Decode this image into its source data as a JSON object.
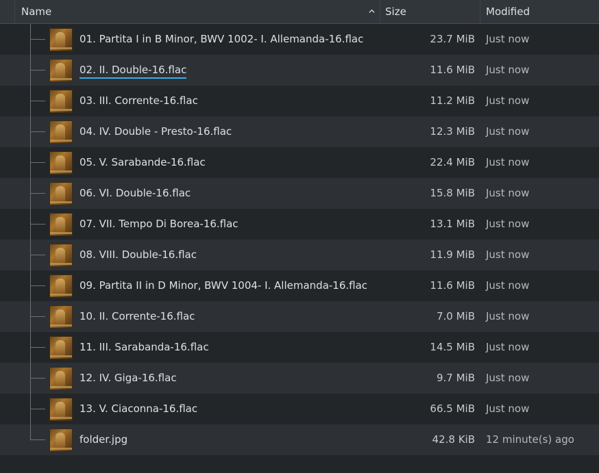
{
  "header": {
    "name_label": "Name",
    "size_label": "Size",
    "modified_label": "Modified",
    "sort_icon": "chevron-up-icon"
  },
  "files": [
    {
      "name": "01. Partita I in B Minor, BWV 1002- I. Allemanda-16.flac",
      "size": "23.7 MiB",
      "modified": "Just now"
    },
    {
      "name": "02. II. Double-16.flac",
      "size": "11.6 MiB",
      "modified": "Just now"
    },
    {
      "name": "03. III. Corrente-16.flac",
      "size": "11.2 MiB",
      "modified": "Just now"
    },
    {
      "name": "04. IV. Double - Presto-16.flac",
      "size": "12.3 MiB",
      "modified": "Just now"
    },
    {
      "name": "05. V. Sarabande-16.flac",
      "size": "22.4 MiB",
      "modified": "Just now"
    },
    {
      "name": "06. VI. Double-16.flac",
      "size": "15.8 MiB",
      "modified": "Just now"
    },
    {
      "name": "07. VII. Tempo Di Borea-16.flac",
      "size": "13.1 MiB",
      "modified": "Just now"
    },
    {
      "name": "08. VIII. Double-16.flac",
      "size": "11.9 MiB",
      "modified": "Just now"
    },
    {
      "name": "09. Partita II in D Minor, BWV 1004- I. Allemanda-16.flac",
      "size": "11.6 MiB",
      "modified": "Just now"
    },
    {
      "name": "10. II. Corrente-16.flac",
      "size": "7.0 MiB",
      "modified": "Just now"
    },
    {
      "name": "11. III. Sarabanda-16.flac",
      "size": "14.5 MiB",
      "modified": "Just now"
    },
    {
      "name": "12. IV. Giga-16.flac",
      "size": "9.7 MiB",
      "modified": "Just now"
    },
    {
      "name": "13. V. Ciaconna-16.flac",
      "size": "66.5 MiB",
      "modified": "Just now"
    },
    {
      "name": "folder.jpg",
      "size": "42.8 KiB",
      "modified": "12 minute(s) ago"
    }
  ],
  "focused_index": 1,
  "colors": {
    "background": "#232629",
    "alt_row": "#2d3136",
    "header": "#31363b",
    "focus_underline": "#3daee9",
    "text": "#dde1e4"
  }
}
